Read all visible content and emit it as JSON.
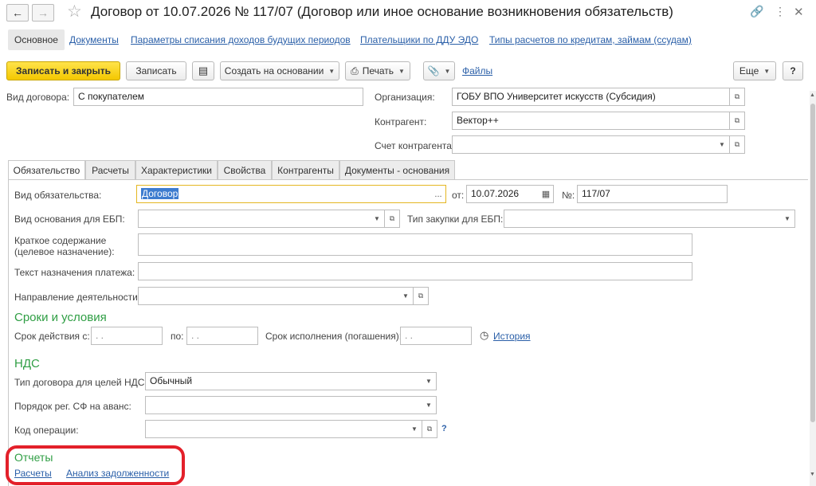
{
  "window": {
    "title": "Договор от 10.07.2026 № 117/07 (Договор или иное основание возникновения обязательств)"
  },
  "nav": {
    "tabs": [
      "Основное",
      "Документы",
      "Параметры списания доходов будущих периодов",
      "Плательщики по ДДУ ЭДО",
      "Типы расчетов по кредитам, займам (ссудам)"
    ]
  },
  "toolbar": {
    "save_close": "Записать и закрыть",
    "save": "Записать",
    "create_based": "Создать на основании",
    "print": "Печать",
    "files": "Файлы",
    "more": "Еще",
    "help": "?"
  },
  "header": {
    "contract_type_label": "Вид договора:",
    "contract_type": "С покупателем",
    "org_label": "Организация:",
    "org": "ГОБУ ВПО Университет искусств (Субсидия)",
    "counterparty_label": "Контрагент:",
    "counterparty": "Вектор++",
    "account_label": "Счет контрагента:",
    "account": ""
  },
  "tabs": [
    "Обязательство",
    "Расчеты",
    "Характеристики",
    "Свойства",
    "Контрагенты",
    "Документы - основания"
  ],
  "obligation": {
    "type_label": "Вид обязательства:",
    "type": "Договор",
    "date_label": "от:",
    "date": "10.07.2026",
    "number_label": "№:",
    "number": "117/07",
    "basis_label": "Вид основания для ЕБП:",
    "basis": "",
    "purchase_label": "Тип закупки для ЕБП:",
    "purchase": "",
    "summary_label_1": "Краткое содержание",
    "summary_label_2": "(целевое назначение):",
    "summary": "",
    "payment_text_label": "Текст назначения платежа:",
    "payment_text": "",
    "activity_label": "Направление деятельности:",
    "activity": ""
  },
  "terms": {
    "heading": "Сроки и условия",
    "from_label": "Срок действия с:",
    "from": " .  .",
    "to_label": "по:",
    "to": " .  .",
    "due_label": "Срок исполнения (погашения):",
    "due": " .  .",
    "history": "История"
  },
  "vat": {
    "heading": "НДС",
    "type_label": "Тип договора для целей НДС:",
    "type": "Обычный",
    "order_label": "Порядок рег. СФ на аванс:",
    "order": "",
    "op_label": "Код операции:",
    "op": "",
    "help": "?"
  },
  "reports": {
    "heading": "Отчеты",
    "links": [
      "Расчеты",
      "Анализ задолженности"
    ],
    "highlight_color": "#e3202a"
  }
}
